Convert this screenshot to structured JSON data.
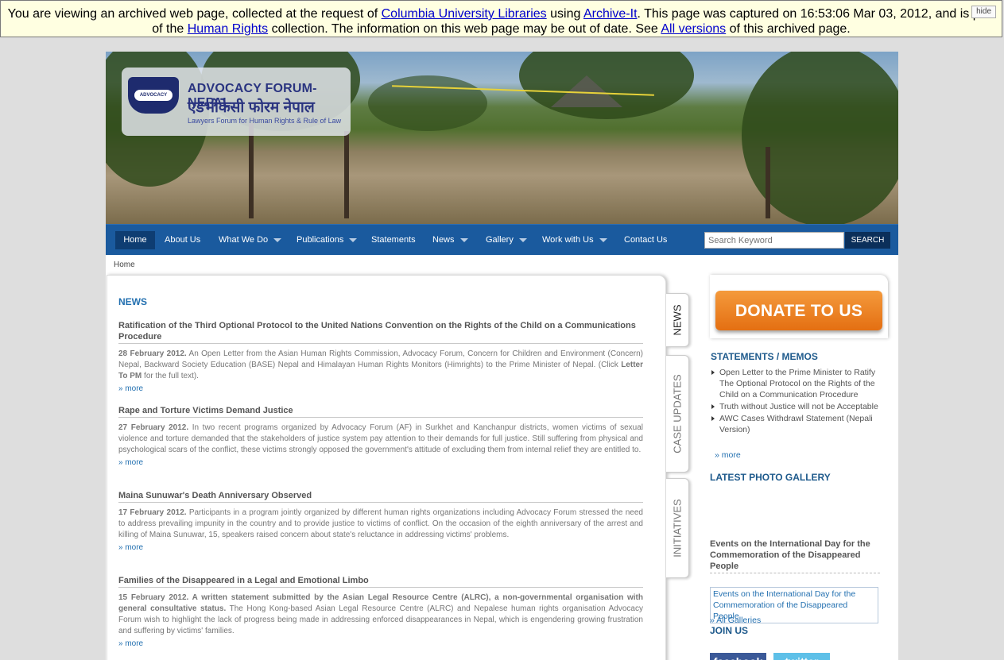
{
  "archive_banner": {
    "t1": "You are viewing an archived web page, collected at the request of ",
    "link_library": "Columbia University Libraries",
    "t2": " using ",
    "link_archiveit": "Archive-It",
    "t3": ". This page was captured on 16:53:06 Mar 03, 2012, and is part of the ",
    "link_collection": "Human Rights",
    "t4": " collection. The information on this web page may be out of date. See ",
    "link_versions": "All versions",
    "t5": " of this archived page.",
    "hide_label": "hide"
  },
  "logo": {
    "title": "ADVOCACY FORUM-NEPAL",
    "native": "एडभोकेसी फोरम नेपाल",
    "tagline": "Lawyers Forum for Human Rights & Rule of Law",
    "emblem_text": "ADVOCACY FORUM"
  },
  "nav": {
    "items": [
      "Home",
      "About Us",
      "What We Do",
      "Publications",
      "Statements",
      "News",
      "Gallery",
      "Work with Us",
      "Contact Us"
    ],
    "search_placeholder": "Search Keyword",
    "search_button": "SEARCH"
  },
  "breadcrumb": "Home",
  "news": {
    "heading": "NEWS",
    "articles": [
      {
        "title": "Ratification of the Third Optional Protocol to the United Nations Convention on the Rights of the Child on a Communications Procedure",
        "date": "28 February 2012.",
        "body": " An Open Letter from the Asian Human Rights Commission, Advocacy Forum, Concern for Children and Environment (Concern) Nepal, Backward Society Education (BASE) Nepal and Himalayan Human Rights Monitors (Himrights) to the Prime Minister of Nepal. (Click ",
        "bold": "Letter To PM",
        "body_end": " for the full text).",
        "more": "» more"
      },
      {
        "title": "Rape and Torture Victims Demand Justice",
        "date": "27 February 2012.",
        "body": " In two recent programs organized by Advocacy Forum (AF) in Surkhet and Kanchanpur districts, women victims of sexual violence and torture demanded that the stakeholders of justice system pay attention to their demands for full justice. Still suffering from physical and psychological scars of the conflict, these victims strongly opposed the government's attitude of excluding them from internal relief they are entitled to.",
        "more": "» more"
      },
      {
        "title": "Maina Sunuwar's Death Anniversary Observed",
        "date": "17 February 2012.",
        "body": " Participants in a program jointly organized by different human rights organizations including Advocacy Forum stressed the need to address prevailing impunity in the country and to provide justice to victims of conflict. On the occasion of the eighth anniversary of the arrest and killing of Maina Sunuwar, 15, speakers raised concern about state's reluctance in addressing victims' problems.",
        "more": "» more"
      },
      {
        "title": "Families of the Disappeared in a Legal and Emotional Limbo",
        "date": "15 February 2012.",
        "bold_lead": " A written statement submitted by the Asian Legal Resource Centre (ALRC), a non-governmental organisation with general consultative status.",
        "body": " The Hong Kong-based Asian Legal Resource Centre (ALRC) and Nepalese human rights organisation Advocacy Forum wish to highlight the lack of progress being made in addressing enforced disappearances in Nepal, which is engendering growing frustration and suffering by victims' families.",
        "more": "» more"
      }
    ]
  },
  "tabs": [
    "NEWS",
    "CASE UPDATES",
    "INITIATIVES"
  ],
  "sidebar": {
    "donate": "DONATE TO US",
    "statements_heading": "STATEMENTS / MEMOS",
    "statements": [
      "Open Letter to the Prime Minister to Ratify The Optional Protocol on the Rights of the Child on a Communication Procedure",
      "Truth without Justice will not be Acceptable",
      "AWC Cases Withdrawl Statement (Nepali Version)"
    ],
    "statements_more": "» more",
    "gallery_heading": "LATEST PHOTO GALLERY",
    "gallery_title": "Events on the International Day for the Commemoration of the Disappeared People",
    "gallery_link": "Events on the International Day for the Commemoration of the Disappeared People",
    "gallery_all": "» All Galleries",
    "join_heading": "JOIN US",
    "facebook": "facebook",
    "twitter": "twitter"
  }
}
